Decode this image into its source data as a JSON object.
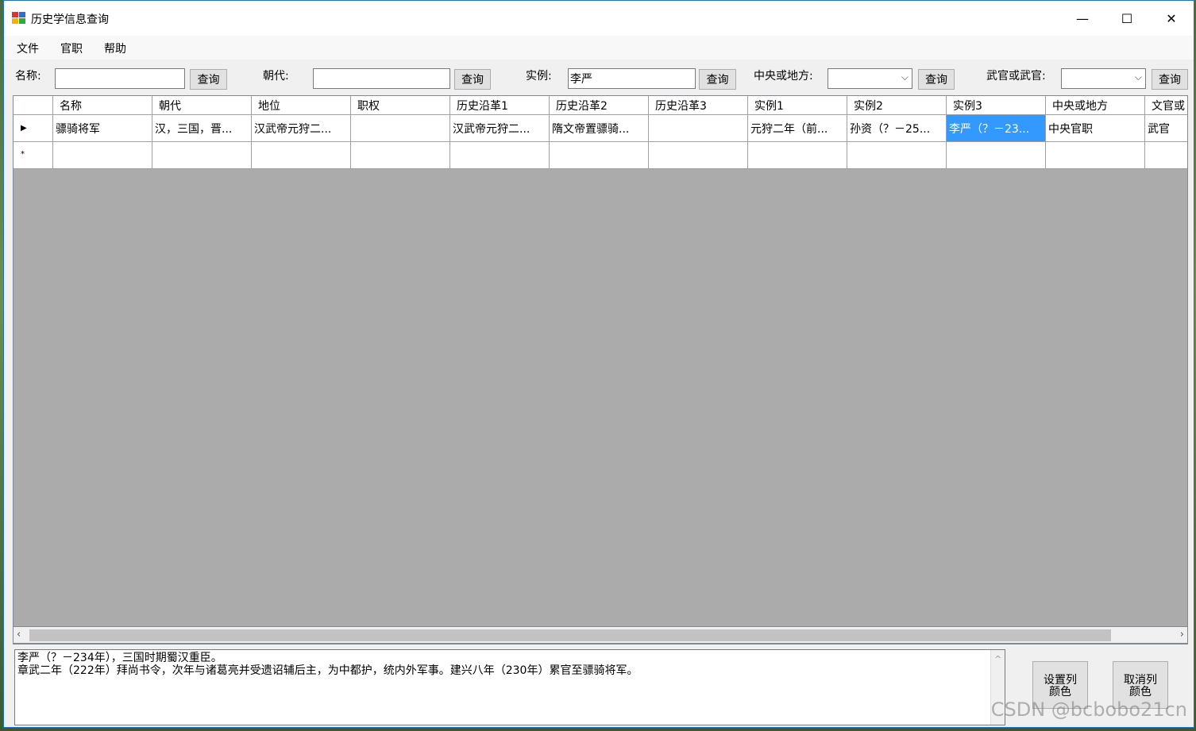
{
  "window": {
    "title": "历史学信息查询",
    "minimize": "—",
    "maximize": "☐",
    "close": "✕"
  },
  "menu": [
    "文件",
    "官职",
    "帮助"
  ],
  "filters": {
    "name_label": "名称:",
    "name_value": "",
    "dynasty_label": "朝代:",
    "dynasty_value": "",
    "example_label": "实例:",
    "example_value": "李严",
    "central_label": "中央或地方:",
    "military_label": "武官或武官:",
    "query": "查询"
  },
  "table": {
    "columns": [
      "名称",
      "朝代",
      "地位",
      "职权",
      "历史沿革1",
      "历史沿革2",
      "历史沿革3",
      "实例1",
      "实例2",
      "实例3",
      "中央或地方",
      "文官或"
    ],
    "rows": [
      [
        "骠骑将军",
        "汉，三国，晋...",
        "汉武帝元狩二...",
        "",
        "汉武帝元狩二...",
        "隋文帝置骠骑...",
        "",
        "元狩二年（前...",
        "孙资（？－25...",
        "李严（？－23...",
        "中央官职",
        "武官"
      ]
    ],
    "new_row_marker": "*",
    "current_row_marker": "▶"
  },
  "detail_text": {
    "line1": "李严（？－234年），三国时期蜀汉重臣。",
    "line2": "章武二年（222年）拜尚书令，次年与诸葛亮并受遗诏辅后主，为中都护，统内外军事。建兴八年（230年）累官至骠骑将军。"
  },
  "buttons": {
    "set_color": [
      "设置列",
      "颜色"
    ],
    "cancel_color": [
      "取消列",
      "颜色"
    ]
  },
  "watermark": "CSDN @bcbobo21cn"
}
